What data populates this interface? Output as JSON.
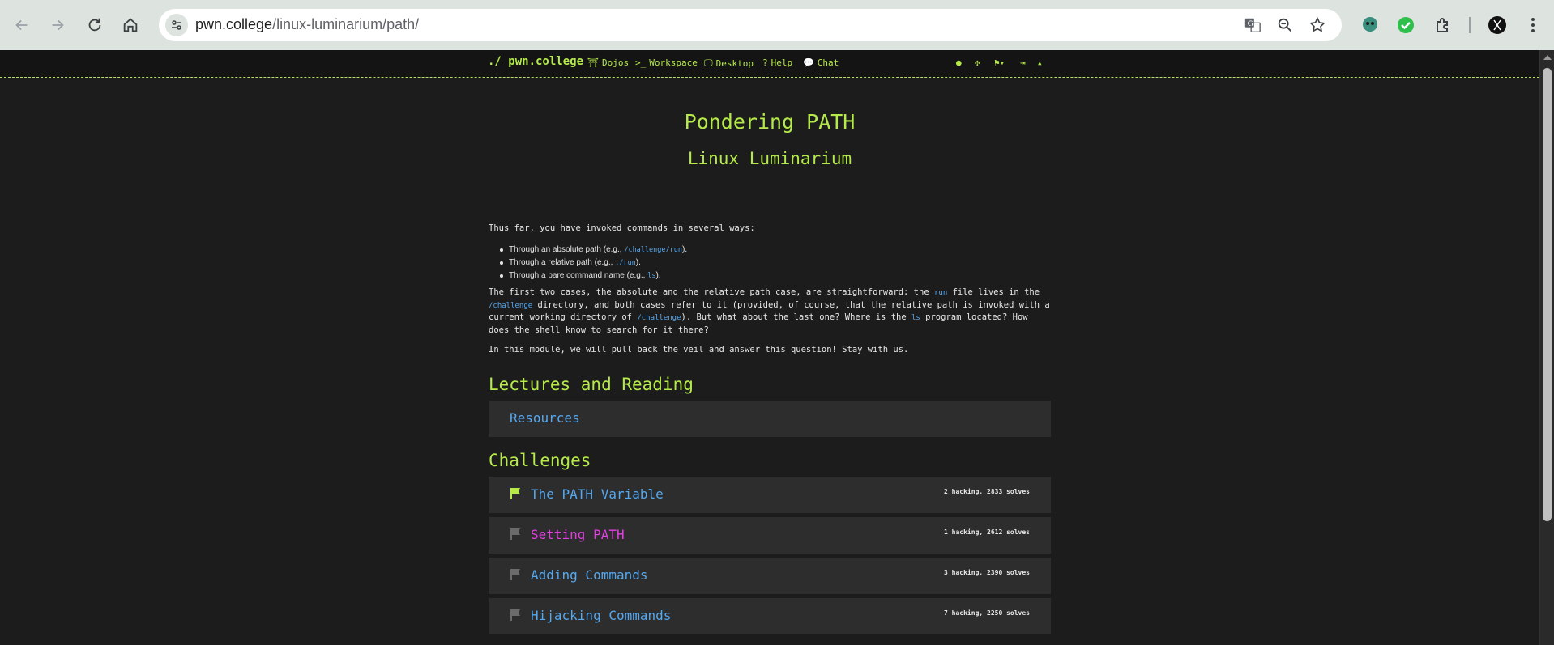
{
  "browser": {
    "url_host": "pwn.college",
    "url_path": "/linux-luminarium/path/"
  },
  "nav": {
    "brand": "./ pwn.college",
    "items": [
      {
        "icon": "torii-gate-icon",
        "label": "Dojos"
      },
      {
        "icon": "terminal-icon",
        "label": "Workspace"
      },
      {
        "icon": "desktop-icon",
        "label": "Desktop"
      },
      {
        "icon": "question-icon",
        "label": "Help"
      },
      {
        "icon": "chat-icon",
        "label": "Chat"
      }
    ]
  },
  "page": {
    "title": "Pondering PATH",
    "subtitle": "Linux Luminarium",
    "intro": "Thus far, you have invoked commands in several ways:",
    "bullets": [
      {
        "text": "Through an absolute path (e.g., ",
        "code": "/challenge/run",
        "suffix": ")."
      },
      {
        "text": "Through a relative path (e.g., ",
        "code": "./run",
        "suffix": ")."
      },
      {
        "text": "Through a bare command name (e.g., ",
        "code": "ls",
        "suffix": ")."
      }
    ],
    "para2": {
      "a": "The first two cases, the absolute and the relative path case, are straightforward: the ",
      "code1": "run",
      "b": " file lives in the ",
      "code2": "/challenge",
      "c": " directory, and both cases refer to it (provided, of course, that the relative path is invoked with a current working directory of ",
      "code3": "/challenge",
      "d": "). But what about the last one? Where is the ",
      "code4": "ls",
      "e": " program located? How does the shell know to search for it there?"
    },
    "para3": "In this module, we will pull back the veil and answer this question! Stay with us.",
    "lectures_heading": "Lectures and Reading",
    "resources_label": "Resources",
    "challenges_heading": "Challenges",
    "challenges": [
      {
        "name": "The PATH Variable",
        "stats": "2 hacking, 2833 solves",
        "solved": true,
        "color": "#56a8ef"
      },
      {
        "name": "Setting PATH",
        "stats": "1 hacking, 2612 solves",
        "solved": false,
        "color": "#e040e0"
      },
      {
        "name": "Adding Commands",
        "stats": "3 hacking, 2390 solves",
        "solved": false,
        "color": "#56a8ef"
      },
      {
        "name": "Hijacking Commands",
        "stats": "7 hacking, 2250 solves",
        "solved": false,
        "color": "#56a8ef"
      }
    ]
  },
  "colors": {
    "accent": "#b5ea4a",
    "link": "#56a8ef",
    "highlight": "#e040e0",
    "background": "#1c1c1c"
  }
}
